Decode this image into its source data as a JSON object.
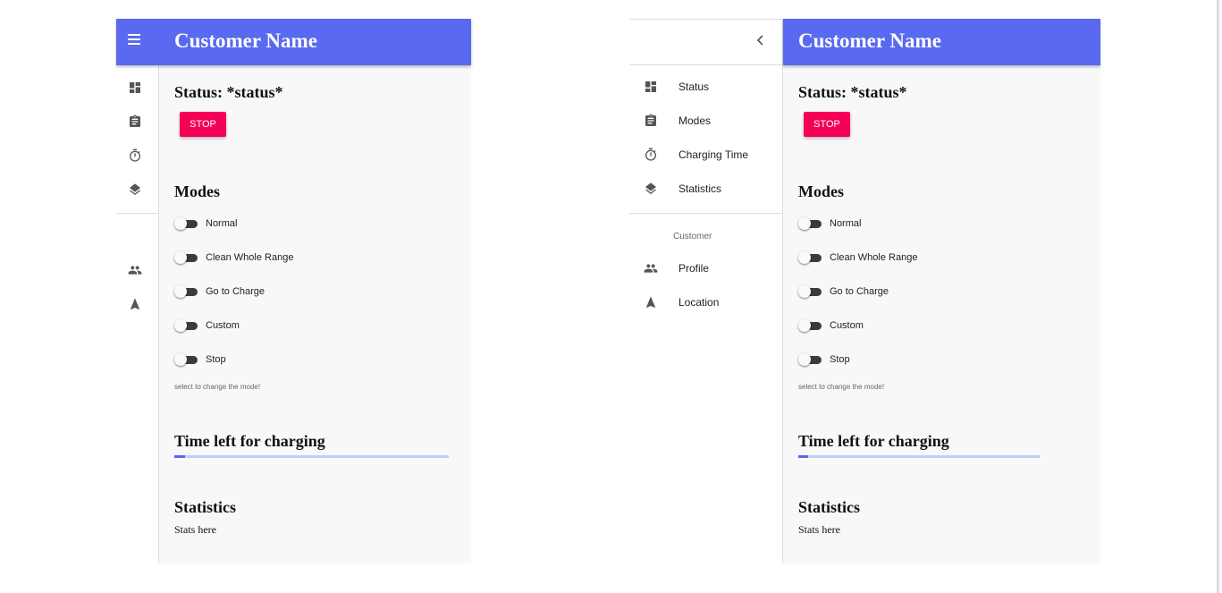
{
  "app_title": "Customer Name",
  "status": {
    "heading": "Status: *status*",
    "stop_label": "STOP"
  },
  "modes": {
    "heading": "Modes",
    "options": [
      "Normal",
      "Clean Whole Range",
      "Go to Charge",
      "Custom",
      "Stop"
    ],
    "helper": "select to change the mode!"
  },
  "charging": {
    "heading": "Time left for charging",
    "progress_fraction": 0.04
  },
  "statistics": {
    "heading": "Statistics",
    "body": "Stats here"
  },
  "nav": {
    "items": [
      "Status",
      "Modes",
      "Charging Time",
      "Statistics"
    ],
    "customer_header": "Customer",
    "customer_items": [
      "Profile",
      "Location"
    ]
  },
  "icons": {
    "menu": "menu-icon",
    "collapse": "chevron-left-icon",
    "status": "dashboard-icon",
    "modes": "clipboard-icon",
    "charging_time": "timer-icon",
    "statistics": "layers-icon",
    "profile": "people-icon",
    "location": "navigation-icon"
  },
  "colors": {
    "primary": "#5969f0",
    "accent": "#f50057",
    "progress_track": "#c2cdf4",
    "content_bg": "#f8f8f8"
  }
}
